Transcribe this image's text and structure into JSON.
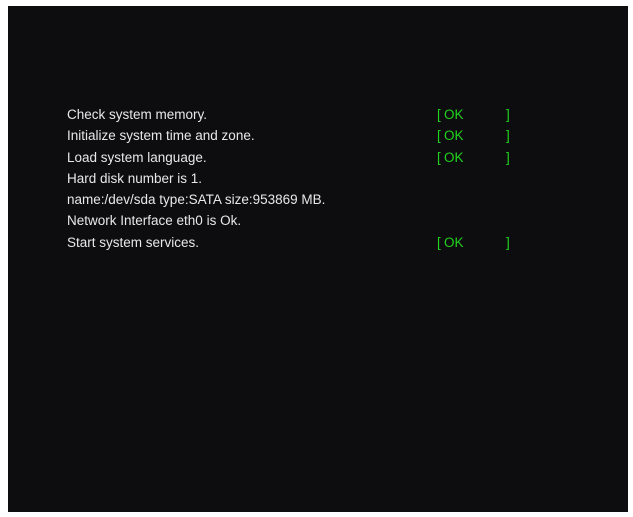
{
  "boot_log": {
    "lines": [
      {
        "message": "Check system memory.",
        "status": {
          "open": "[",
          "text": "OK",
          "close": "]"
        }
      },
      {
        "message": "Initialize system time and zone.",
        "status": {
          "open": "[",
          "text": "OK",
          "close": "]"
        }
      },
      {
        "message": "Load system language.",
        "status": {
          "open": "[",
          "text": "OK",
          "close": "]"
        }
      },
      {
        "message": "Hard disk number is 1."
      },
      {
        "message": "name:/dev/sda type:SATA size:953869 MB."
      },
      {
        "message": "Network Interface eth0 is Ok."
      },
      {
        "message": "Start system services.",
        "status": {
          "open": "[",
          "text": "OK",
          "close": "]"
        }
      }
    ]
  },
  "colors": {
    "background": "#0d0d0f",
    "text": "#e8e8e8",
    "ok_status": "#22d21e"
  }
}
